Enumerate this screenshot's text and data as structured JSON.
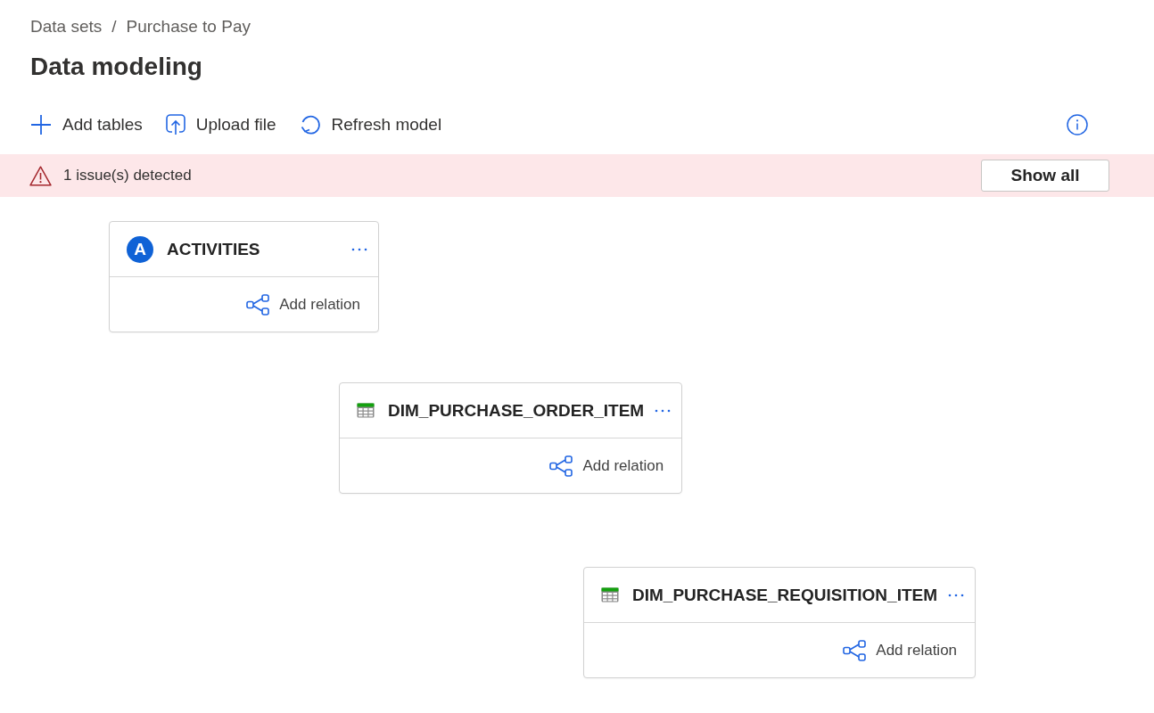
{
  "breadcrumb": {
    "items": [
      "Data sets",
      "Purchase to Pay"
    ],
    "separator": "/"
  },
  "title": "Data modeling",
  "toolbar": [
    {
      "kind": "add",
      "label": "Add tables"
    },
    {
      "kind": "upload",
      "label": "Upload file"
    },
    {
      "kind": "refresh",
      "label": "Refresh model"
    }
  ],
  "issue_bar": {
    "message": "1 issue(s) detected",
    "button": "Show all"
  },
  "tables": [
    {
      "kind": "activity",
      "badge": "A",
      "name": "ACTIVITIES",
      "action": "Add relation"
    },
    {
      "kind": "table",
      "name": "DIM_PURCHASE_ORDER_ITEM",
      "action": "Add relation"
    },
    {
      "kind": "table",
      "name": "DIM_PURCHASE_REQUISITION_ITEM",
      "action": "Add relation"
    }
  ]
}
